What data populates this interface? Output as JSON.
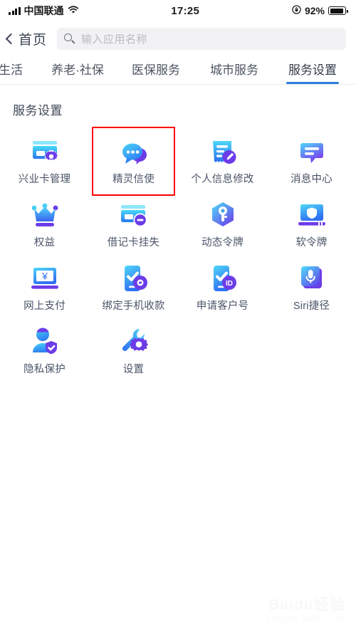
{
  "status_bar": {
    "carrier": "中国联通",
    "signal_icon": "signal-bars-icon",
    "wifi_icon": "wifi-icon",
    "time": "17:25",
    "rotation_lock_icon": "rotation-lock-icon",
    "battery_percent": "92%",
    "battery_icon": "battery-icon",
    "battery_level": 92
  },
  "navbar": {
    "back_icon": "chevron-left-icon",
    "back_label": "首页",
    "search_icon": "search-icon",
    "search_placeholder": "输入应用名称",
    "search_value": ""
  },
  "tabs": {
    "items": [
      {
        "label": "生活",
        "active": false,
        "partial": true
      },
      {
        "label": "养老·社保",
        "active": false
      },
      {
        "label": "医保服务",
        "active": false
      },
      {
        "label": "城市服务",
        "active": false
      },
      {
        "label": "服务设置",
        "active": true
      }
    ],
    "active_underline_color": "#2e7fe0"
  },
  "section": {
    "title": "服务设置"
  },
  "grid": {
    "items": [
      {
        "label": "兴业卡管理",
        "icon": "card-gear-icon",
        "highlighted": false
      },
      {
        "label": "精灵信使",
        "icon": "chat-bubble-icon",
        "highlighted": true
      },
      {
        "label": "个人信息修改",
        "icon": "document-pencil-icon",
        "highlighted": false
      },
      {
        "label": "消息中心",
        "icon": "message-bubble-icon",
        "highlighted": false
      },
      {
        "label": "权益",
        "icon": "crown-icon",
        "highlighted": false
      },
      {
        "label": "借记卡挂失",
        "icon": "card-minus-icon",
        "highlighted": false
      },
      {
        "label": "动态令牌",
        "icon": "hexagon-key-icon",
        "highlighted": false
      },
      {
        "label": "软令牌",
        "icon": "laptop-shield-icon",
        "highlighted": false
      },
      {
        "label": "网上支付",
        "icon": "laptop-yuan-icon",
        "highlighted": false
      },
      {
        "label": "绑定手机收款",
        "icon": "phone-check-link-icon",
        "highlighted": false
      },
      {
        "label": "申请客户号",
        "icon": "phone-check-id-icon",
        "highlighted": false
      },
      {
        "label": "Siri捷径",
        "icon": "microphone-icon",
        "highlighted": false
      },
      {
        "label": "隐私保护",
        "icon": "person-shield-icon",
        "highlighted": false
      },
      {
        "label": "设置",
        "icon": "wrench-gear-icon",
        "highlighted": false
      }
    ],
    "highlight_color": "#ff0000"
  },
  "watermark": {
    "brand": "Baidu经验",
    "url": "jingyan.baidu.com"
  },
  "colors": {
    "accent_blue": "#2e7fe0",
    "icon_cyan": "#3fd0f5",
    "icon_blue": "#2f7ff0",
    "icon_purple": "#6c3ce8",
    "label_text": "#4a5468",
    "search_bg": "#f2f2f4"
  }
}
